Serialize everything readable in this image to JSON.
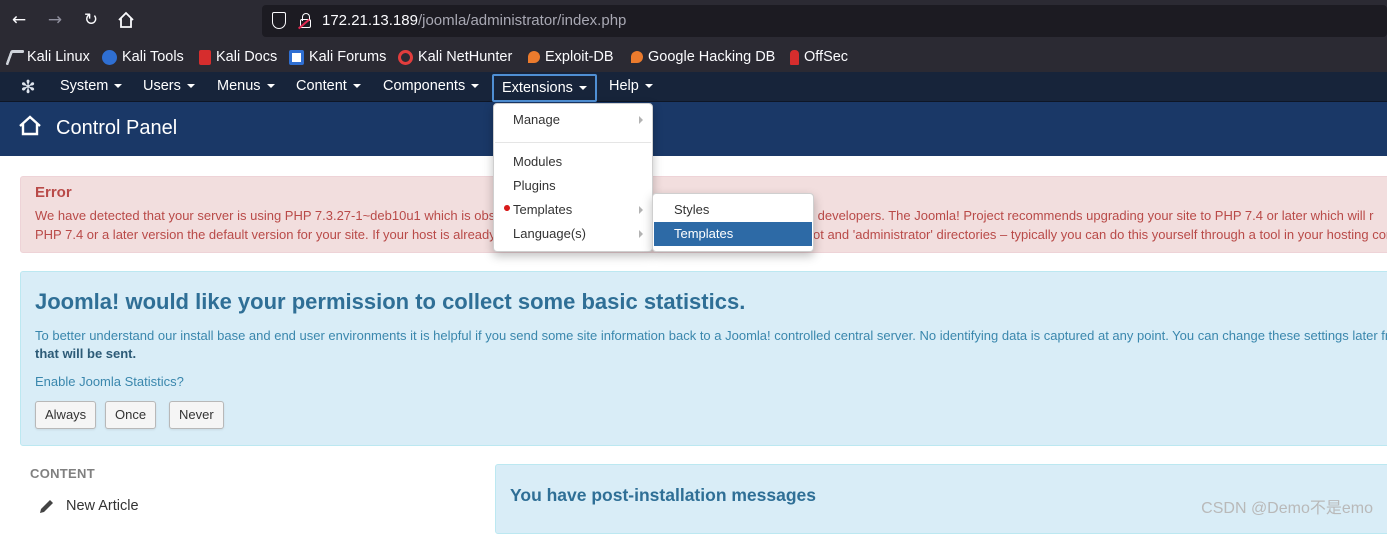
{
  "browser": {
    "url_host": "172.21.13.189",
    "url_path": "/joomla/administrator/index.php",
    "bookmarks": [
      "Kali Linux",
      "Kali Tools",
      "Kali Docs",
      "Kali Forums",
      "Kali NetHunter",
      "Exploit-DB",
      "Google Hacking DB",
      "OffSec"
    ]
  },
  "topnav": {
    "items": [
      "System",
      "Users",
      "Menus",
      "Content",
      "Components",
      "Extensions",
      "Help"
    ],
    "active": "Extensions"
  },
  "header": {
    "title": "Control Panel"
  },
  "extensions_menu": {
    "items": [
      "Manage",
      "Modules",
      "Plugins",
      "Templates",
      "Language(s)"
    ]
  },
  "templates_submenu": {
    "items": [
      "Styles",
      "Templates"
    ],
    "highlighted": "Templates"
  },
  "error_alert": {
    "heading": "Error",
    "line1_left": "We have detected that your server is using PHP 7.3.27-1~deb10u1 which is obs",
    "line1_right": "its developers. The Joomla! Project recommends upgrading your site to PHP 7.4 or later which will r",
    "line2_left": "PHP 7.4 or a later version the default version for your site. If your host is already",
    "line2_right": "ot and 'administrator' directories – typically you can do this yourself through a tool in your hosting cor"
  },
  "stats_message": {
    "title": "Joomla! would like your permission to collect some basic statistics.",
    "text": "To better understand our install base and end user environments it is helpful if you send some site information back to a Joomla! controlled central server. No identifying data is captured at any point. You can change these settings later fr",
    "text_bold": "that will be sent.",
    "link": "Enable Joomla Statistics?",
    "buttons": [
      "Always",
      "Once",
      "Never"
    ]
  },
  "sidebar": {
    "section_label": "CONTENT",
    "items": [
      "New Article"
    ]
  },
  "postinstall": {
    "title": "You have post-installation messages"
  },
  "watermark": "CSDN @Demo不是emo",
  "colors": {
    "browser_chrome": "#2b2a33",
    "joomla_nav": "#17243a",
    "joomla_header": "#1a3867",
    "error_bg": "#f2dede",
    "info_bg": "#d9edf7",
    "highlight": "#2d6aa6"
  }
}
